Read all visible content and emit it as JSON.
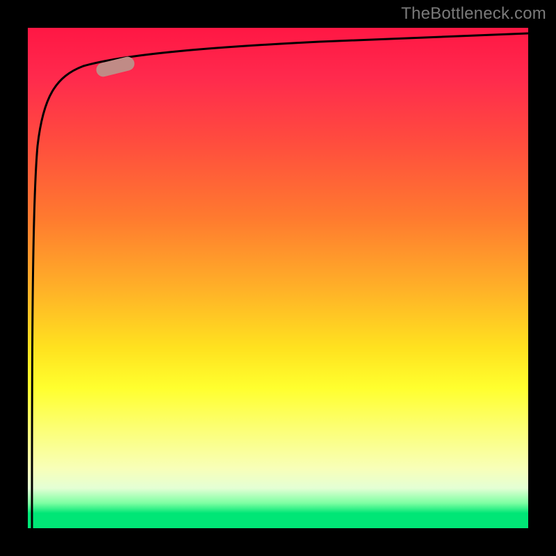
{
  "watermark": {
    "text": "TheBottleneck.com"
  },
  "chart_data": {
    "type": "line",
    "title": "",
    "xlabel": "",
    "ylabel": "",
    "xlim": [
      0,
      100
    ],
    "ylim": [
      0,
      100
    ],
    "grid": false,
    "series": [
      {
        "name": "curve",
        "x": [
          0,
          1,
          2,
          3,
          5,
          8,
          12,
          18,
          25,
          40,
          60,
          80,
          100
        ],
        "values": [
          0,
          60,
          78,
          85,
          89,
          91,
          92.5,
          93.5,
          94.2,
          95.2,
          96.2,
          97,
          97.8
        ]
      }
    ],
    "marker": {
      "x_range": [
        12,
        20
      ],
      "y_range": [
        92.2,
        93.6
      ],
      "color": "#c08b86"
    },
    "background_gradient": {
      "top": "#ff1744",
      "middle": "#ffff2e",
      "bottom": "#00e676"
    },
    "colors": {
      "curve": "#000000",
      "frame": "#000000",
      "watermark": "#7a7a7a"
    }
  }
}
